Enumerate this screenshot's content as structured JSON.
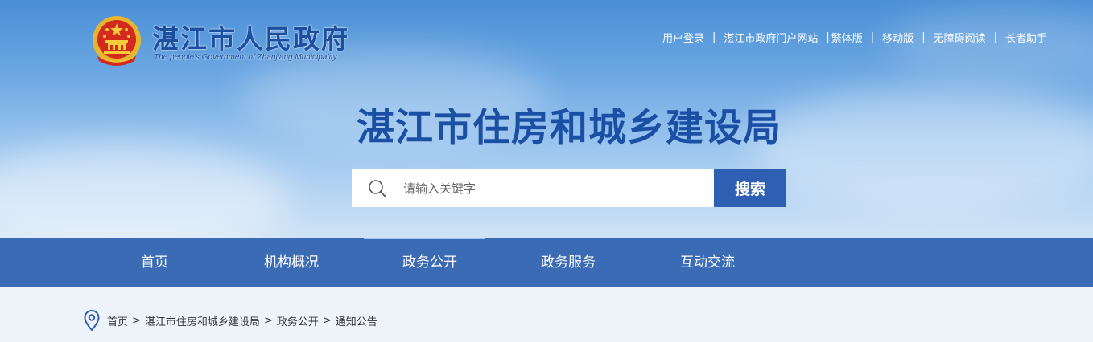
{
  "header": {
    "gov_title": "湛江市人民政府",
    "gov_subtitle": "The people's Government of Zhanjiang Municipality",
    "site_title": "湛江市住房和城乡建设局",
    "colors": {
      "title_blue": "#1a4fa3",
      "nav_blue": "#3c6bb5",
      "button_blue": "#2e5fb3"
    }
  },
  "toplinks": [
    "用户登录",
    "湛江市政府门户网站",
    "繁体版",
    "移动版",
    "无障碍阅读",
    "长者助手"
  ],
  "search": {
    "placeholder": "请输入关键字",
    "button_label": "搜索",
    "icon": "search-icon"
  },
  "nav": [
    "首页",
    "机构概况",
    "政务公开",
    "政务服务",
    "互动交流"
  ],
  "breadcrumb": {
    "icon": "location-pin-icon",
    "items": [
      "首页",
      "湛江市住房和城乡建设局",
      "政务公开",
      "通知公告"
    ],
    "separator": ">"
  }
}
